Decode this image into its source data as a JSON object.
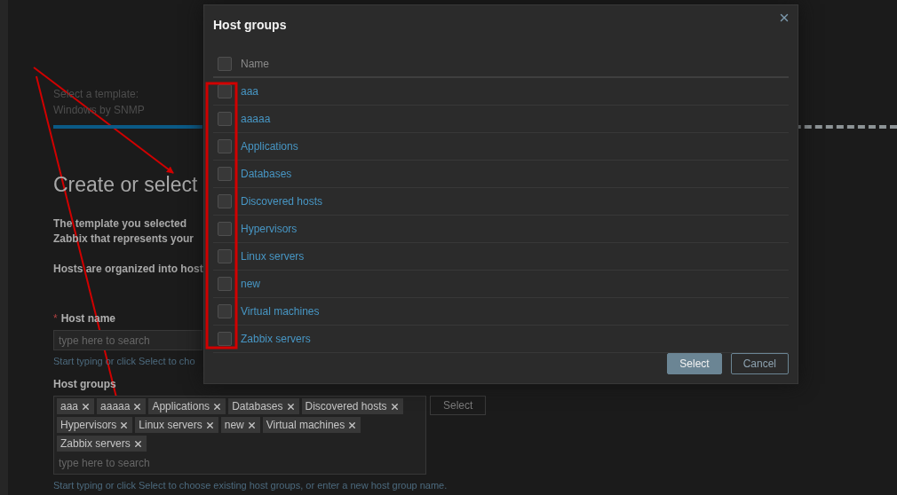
{
  "wizard": {
    "step_label": "Select a template:",
    "step_value": "Windows by SNMP",
    "title": "Create or select",
    "description": [
      "The template you selected",
      "Zabbix that represents your"
    ],
    "note": "Hosts are organized into host",
    "host_name": {
      "marker": "*",
      "label": "Host name",
      "placeholder": "type here to search",
      "hint": "Start typing or click Select to cho"
    },
    "host_groups": {
      "label": "Host groups",
      "tags": [
        "aaa",
        "aaaaa",
        "Applications",
        "Databases",
        "Discovered hosts",
        "Hypervisors",
        "Linux servers",
        "new",
        "Virtual machines",
        "Zabbix servers"
      ],
      "placeholder": "type here to search",
      "button": "Select",
      "hint": "Start typing or click Select to choose existing host groups, or enter a new host group name."
    }
  },
  "modal": {
    "title": "Host groups",
    "header": {
      "label": "Name",
      "checked": false
    },
    "rows": [
      {
        "name": "aaa",
        "checked": false
      },
      {
        "name": "aaaaa",
        "checked": false
      },
      {
        "name": "Applications",
        "checked": false
      },
      {
        "name": "Databases",
        "checked": false
      },
      {
        "name": "Discovered hosts",
        "checked": false
      },
      {
        "name": "Hypervisors",
        "checked": false
      },
      {
        "name": "Linux servers",
        "checked": false
      },
      {
        "name": "new",
        "checked": false
      },
      {
        "name": "Virtual machines",
        "checked": false
      },
      {
        "name": "Zabbix servers",
        "checked": false
      }
    ],
    "buttons": [
      {
        "label": "Select",
        "kind": "primary"
      },
      {
        "label": "Cancel",
        "kind": "secondary"
      }
    ]
  }
}
